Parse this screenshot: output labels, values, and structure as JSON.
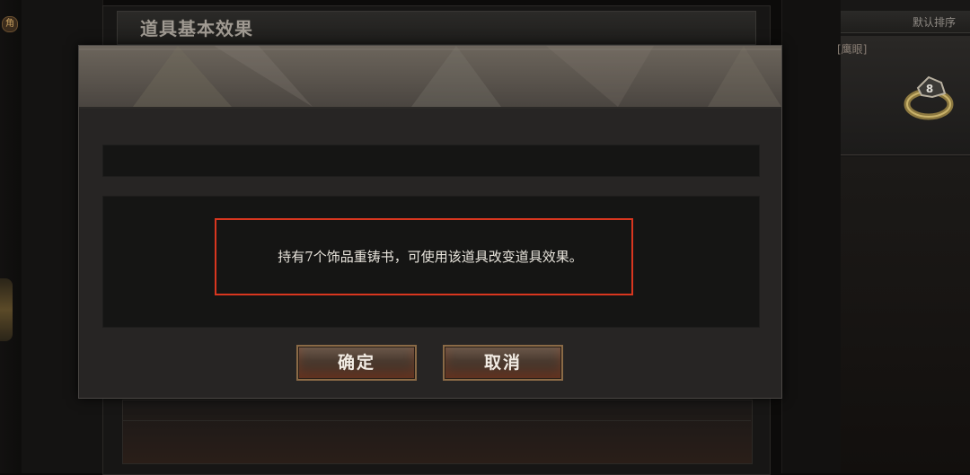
{
  "background": {
    "left_badge": "角",
    "panel_title": "道具基本效果",
    "sort_label": "默认排序",
    "item_tag": "[鹰眼]",
    "item_icon": "ring-icon"
  },
  "dialog": {
    "message": "持有7个饰品重铸书，可使用该道具改变道具效果。",
    "confirm_label": "确定",
    "cancel_label": "取消",
    "highlight_color": "#d8361f"
  }
}
